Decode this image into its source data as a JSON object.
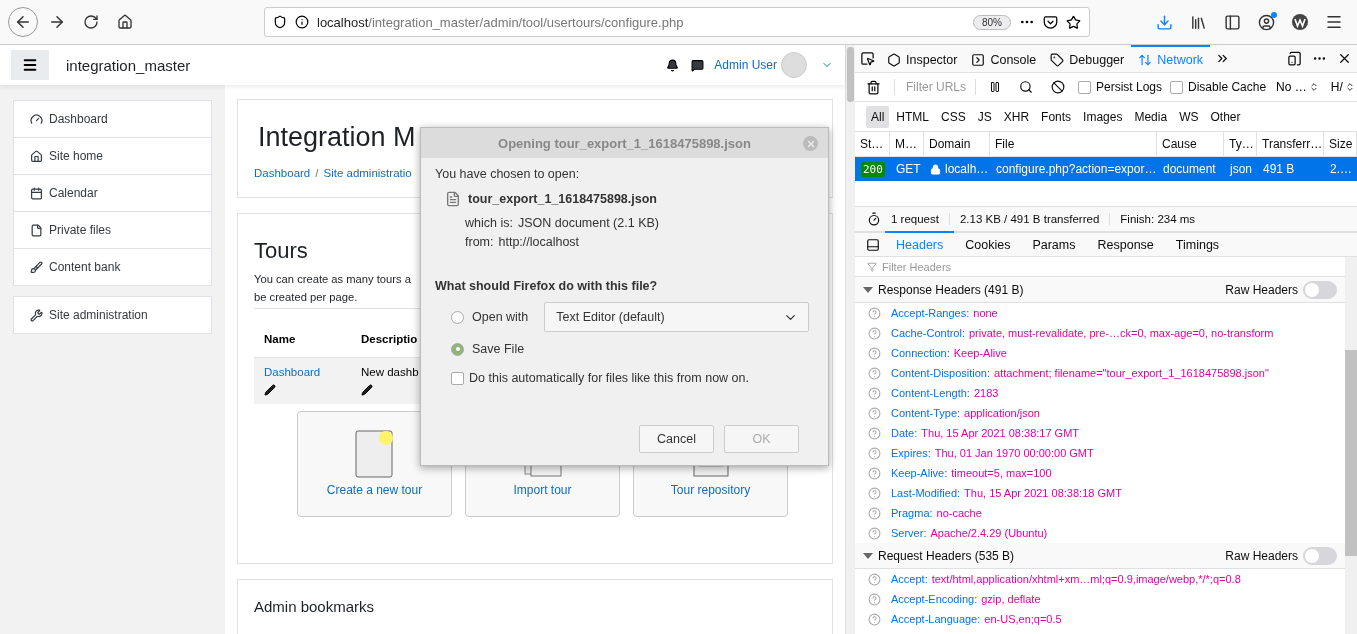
{
  "browser": {
    "url_host": "localhost",
    "url_path": "/integration_master/admin/tool/usertours/configure.php",
    "zoom": "80%"
  },
  "navbar": {
    "site_name": "integration_master",
    "user_name": "Admin User"
  },
  "sidebar": {
    "groups": [
      [
        {
          "label": "Dashboard"
        },
        {
          "label": "Site home"
        },
        {
          "label": "Calendar"
        },
        {
          "label": "Private files"
        },
        {
          "label": "Content bank"
        }
      ],
      [
        {
          "label": "Site administration"
        }
      ]
    ]
  },
  "page_header": {
    "title": "Integration M",
    "breadcrumb": [
      "Dashboard",
      "Site administratio"
    ],
    "separator": "/"
  },
  "tours": {
    "title": "Tours",
    "intro_lines": [
      "You can create as many tours a",
      "be created per page."
    ],
    "columns": [
      "Name",
      "Descriptio"
    ],
    "rows": [
      {
        "name": "Dashboard",
        "description": "New dashb"
      }
    ],
    "actions": [
      {
        "label": "Create a new tour"
      },
      {
        "label": "Import tour"
      },
      {
        "label": "Tour repository"
      }
    ]
  },
  "admin_bookmarks": {
    "title": "Admin bookmarks"
  },
  "dialog": {
    "title": "Opening tour_export_1_1618475898.json",
    "intro": "You have chosen to open:",
    "file_name": "tour_export_1_1618475898.json",
    "details": [
      {
        "label": "which is:",
        "value": "JSON document (2.1 KB)"
      },
      {
        "label": "from:",
        "value": "http://localhost"
      }
    ],
    "question": "What should Firefox do with this file?",
    "options": [
      {
        "label": "Open with",
        "selected": false
      },
      {
        "label": "Save File",
        "selected": true
      }
    ],
    "application": "Text Editor (default)",
    "auto": {
      "label": "Do this automatically for files like this from now on.",
      "checked": false
    },
    "buttons": [
      {
        "label": "Cancel",
        "disabled": false
      },
      {
        "label": "OK",
        "disabled": true
      }
    ]
  },
  "devtools": {
    "tools": [
      {
        "label": "Inspector",
        "selected": false
      },
      {
        "label": "Console",
        "selected": false
      },
      {
        "label": "Debugger",
        "selected": false
      },
      {
        "label": "Network",
        "selected": true
      }
    ],
    "filter_placeholder": "Filter URLs",
    "checkboxes": [
      {
        "label": "Persist Logs",
        "checked": false
      },
      {
        "label": "Disable Cache",
        "checked": false
      }
    ],
    "selects": [
      "No …",
      "H/"
    ],
    "type_filters": [
      {
        "label": "All",
        "selected": true
      },
      {
        "label": "HTML",
        "selected": false
      },
      {
        "label": "CSS",
        "selected": false
      },
      {
        "label": "JS",
        "selected": false
      },
      {
        "label": "XHR",
        "selected": false
      },
      {
        "label": "Fonts",
        "selected": false
      },
      {
        "label": "Images",
        "selected": false
      },
      {
        "label": "Media",
        "selected": false
      },
      {
        "label": "WS",
        "selected": false
      },
      {
        "label": "Other",
        "selected": false
      }
    ],
    "columns": [
      "St…",
      "M…",
      "Domain",
      "File",
      "Cause",
      "Ty…",
      "Transferr…",
      "Size"
    ],
    "requests": [
      {
        "status": "200",
        "method": "GET",
        "domain": "localh…",
        "file": "configure.php?action=expor…",
        "cause": "document",
        "type": "json",
        "transferred": "491 B",
        "size": "2.…",
        "selected": true
      }
    ],
    "summary": [
      "1 request",
      "2.13 KB / 491 B transferred",
      "Finish: 234 ms"
    ],
    "detail_tabs": [
      {
        "label": "Headers",
        "selected": true
      },
      {
        "label": "Cookies",
        "selected": false
      },
      {
        "label": "Params",
        "selected": false
      },
      {
        "label": "Response",
        "selected": false
      },
      {
        "label": "Timings",
        "selected": false
      }
    ],
    "filter_headers_placeholder": "Filter Headers",
    "sections": [
      {
        "title": "Response Headers (491 B)",
        "expanded": true,
        "raw_label": "Raw Headers",
        "raw_on": false,
        "headers": [
          {
            "name": "Accept-Ranges:",
            "value": "none"
          },
          {
            "name": "Cache-Control:",
            "value": "private, must-revalidate, pre-…ck=0, max-age=0, no-transform"
          },
          {
            "name": "Connection:",
            "value": "Keep-Alive"
          },
          {
            "name": "Content-Disposition:",
            "value": "attachment; filename=\"tour_export_1_1618475898.json\""
          },
          {
            "name": "Content-Length:",
            "value": "2183"
          },
          {
            "name": "Content-Type:",
            "value": "application/json"
          },
          {
            "name": "Date:",
            "value": "Thu, 15 Apr 2021 08:38:17 GMT"
          },
          {
            "name": "Expires:",
            "value": "Thu, 01 Jan 1970 00:00:00 GMT"
          },
          {
            "name": "Keep-Alive:",
            "value": "timeout=5, max=100"
          },
          {
            "name": "Last-Modified:",
            "value": "Thu, 15 Apr 2021 08:38:18 GMT"
          },
          {
            "name": "Pragma:",
            "value": "no-cache"
          },
          {
            "name": "Server:",
            "value": "Apache/2.4.29 (Ubuntu)"
          }
        ]
      },
      {
        "title": "Request Headers (535 B)",
        "expanded": true,
        "raw_label": "Raw Headers",
        "raw_on": false,
        "headers": [
          {
            "name": "Accept:",
            "value": "text/html,application/xhtml+xm…ml;q=0.9,image/webp,*/*;q=0.8"
          },
          {
            "name": "Accept-Encoding:",
            "value": "gzip, deflate"
          },
          {
            "name": "Accept-Language:",
            "value": "en-US,en;q=0.5"
          }
        ]
      }
    ]
  }
}
